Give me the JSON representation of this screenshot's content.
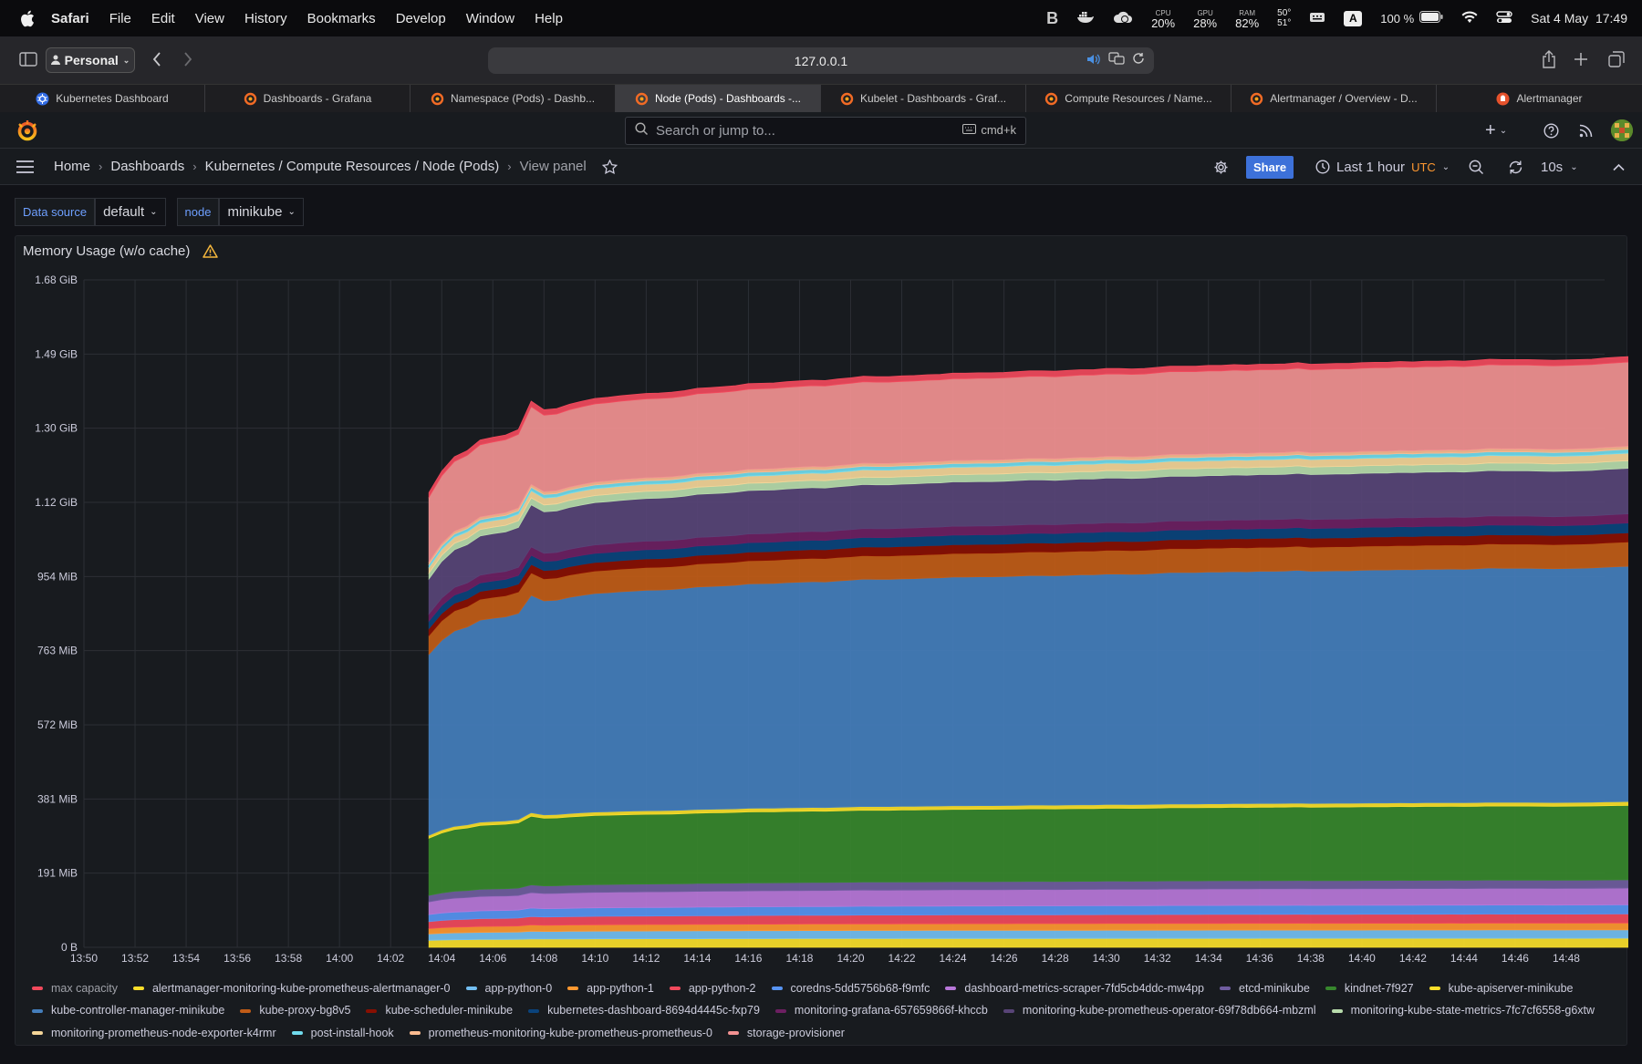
{
  "menubar": {
    "items": [
      "Safari",
      "File",
      "Edit",
      "View",
      "History",
      "Bookmarks",
      "Develop",
      "Window",
      "Help"
    ],
    "stats": [
      {
        "k": "CPU",
        "v": "20%"
      },
      {
        "k": "GPU",
        "v": "28%"
      },
      {
        "k": "RAM",
        "v": "82%"
      }
    ],
    "temp_top": "50°",
    "temp_bottom": "51°",
    "input_source": "A",
    "battery": "100 %",
    "datetime": "Sat 4 May  17:49"
  },
  "browser": {
    "profile": "Personal",
    "url": "127.0.0.1",
    "tabs": [
      {
        "label": "Kubernetes Dashboard",
        "icon": "kubernetes-icon",
        "active": false
      },
      {
        "label": "Dashboards - Grafana",
        "icon": "grafana-icon",
        "active": false
      },
      {
        "label": "Namespace (Pods) - Dashb...",
        "icon": "grafana-icon",
        "active": false
      },
      {
        "label": "Node (Pods) - Dashboards -...",
        "icon": "grafana-icon",
        "active": true
      },
      {
        "label": "Kubelet - Dashboards - Graf...",
        "icon": "grafana-icon",
        "active": false
      },
      {
        "label": "Compute Resources / Name...",
        "icon": "grafana-icon",
        "active": false
      },
      {
        "label": "Alertmanager / Overview - D...",
        "icon": "grafana-icon",
        "active": false
      },
      {
        "label": "Alertmanager",
        "icon": "alertmanager-icon",
        "active": false
      }
    ]
  },
  "grafana": {
    "search_placeholder": "Search or jump to...",
    "search_shortcut": "cmd+k",
    "breadcrumbs": [
      "Home",
      "Dashboards",
      "Kubernetes / Compute Resources / Node (Pods)",
      "View panel"
    ],
    "share_label": "Share",
    "time_range": "Last 1 hour",
    "timezone": "UTC",
    "refresh": "10s",
    "vars": [
      {
        "label": "Data source",
        "value": "default"
      },
      {
        "label": "node",
        "value": "minikube"
      }
    ],
    "panel_title": "Memory Usage (w/o cache)"
  },
  "chart_data": {
    "type": "area",
    "stacked": true,
    "title": "Memory Usage (w/o cache)",
    "y_ticks": [
      "0 B",
      "191 MiB",
      "381 MiB",
      "572 MiB",
      "763 MiB",
      "954 MiB",
      "1.12 GiB",
      "1.30 GiB",
      "1.49 GiB",
      "1.68 GiB"
    ],
    "ylim_mib": [
      0,
      1717
    ],
    "x_ticks": [
      "13:50",
      "13:52",
      "13:54",
      "13:56",
      "13:58",
      "14:00",
      "14:02",
      "14:04",
      "14:06",
      "14:08",
      "14:10",
      "14:12",
      "14:14",
      "14:16",
      "14:18",
      "14:20",
      "14:22",
      "14:24",
      "14:26",
      "14:28",
      "14:30",
      "14:32",
      "14:34",
      "14:36",
      "14:38",
      "14:40",
      "14:42",
      "14:44",
      "14:46",
      "14:48"
    ],
    "x_range_min": [
      0,
      59.5
    ],
    "data_start_min": 13.5,
    "sample_step_min": 0.5,
    "grid": true,
    "legend_position": "bottom",
    "total_mib": [
      1170,
      1225,
      1262,
      1278,
      1305,
      1312,
      1318,
      1332,
      1405,
      1383,
      1386,
      1397,
      1405,
      1412,
      1415,
      1419,
      1422,
      1425,
      1426,
      1428,
      1432,
      1438,
      1440,
      1442,
      1445,
      1450,
      1451,
      1452,
      1455,
      1457,
      1459,
      1458,
      1462,
      1465,
      1469,
      1468,
      1468,
      1470,
      1471,
      1473,
      1474,
      1477,
      1477,
      1478,
      1478,
      1479,
      1481,
      1483,
      1483,
      1482,
      1484,
      1486,
      1486,
      1489,
      1489,
      1488,
      1489,
      1492,
      1495,
      1495,
      1495,
      1497,
      1497,
      1499,
      1498,
      1500,
      1500,
      1501,
      1504,
      1500,
      1501,
      1502,
      1502,
      1504,
      1505,
      1505,
      1507,
      1506,
      1508,
      1508,
      1509,
      1508,
      1510,
      1513,
      1512,
      1512,
      1512,
      1511,
      1510,
      1511,
      1512,
      1513,
      1516,
      1518,
      1520,
      1518,
      1521,
      1522,
      1520,
      1521,
      1520,
      1521,
      1521,
      1523,
      1525,
      1525,
      1525,
      1524,
      1524,
      1525,
      1526,
      1527,
      1528,
      1528,
      1530,
      1530,
      1530,
      1530,
      1531,
      1531,
      1532,
      1534,
      1534,
      1533,
      1533,
      1534,
      1533,
      1534,
      1535,
      1535,
      1536,
      1535,
      1536,
      1537,
      1538,
      1538,
      1539,
      1540,
      1540,
      1541,
      1542,
      1542,
      1543,
      1543,
      1544,
      1544,
      1545,
      1545,
      1546,
      1546,
      1547,
      1547,
      1548,
      1549,
      1550,
      1550,
      1551,
      1551,
      1551,
      1553
    ],
    "series": [
      {
        "name": "max capacity",
        "color": "#f2495c",
        "values_mib": [
          12,
          12,
          12,
          12,
          12,
          12,
          12,
          12,
          14,
          14,
          14,
          14,
          14,
          14,
          14,
          14,
          14,
          14,
          14,
          14,
          14,
          14,
          14,
          14,
          14,
          14,
          14,
          14,
          14,
          14,
          14,
          14,
          14,
          14,
          14,
          14,
          14,
          14,
          14,
          14,
          14,
          14,
          14,
          14,
          14,
          14,
          14,
          14,
          14,
          14,
          14,
          14,
          14,
          14,
          14,
          14,
          14,
          14,
          14,
          14,
          14,
          14,
          14,
          14,
          14,
          14,
          14,
          14,
          14,
          14,
          14,
          14,
          14,
          14,
          14,
          14,
          14,
          14,
          14,
          14,
          14,
          14,
          14,
          14,
          14,
          14,
          14,
          14,
          14,
          14,
          14,
          14,
          14,
          14,
          14,
          14,
          14,
          14,
          14,
          14,
          14,
          14,
          14,
          14,
          14,
          14,
          14,
          14,
          14,
          14,
          14,
          14,
          14,
          14,
          14,
          14,
          14,
          14,
          14,
          14,
          14,
          14,
          14,
          14,
          14,
          14,
          14,
          14,
          14,
          14,
          14,
          14,
          14,
          14,
          14,
          14,
          14,
          14,
          14,
          14,
          14,
          14,
          14,
          14,
          14,
          14,
          14,
          14,
          14,
          14,
          14,
          14,
          14,
          14,
          14,
          14,
          14,
          14,
          14,
          14
        ]
      },
      {
        "name": "alertmanager-monitoring-kube-prometheus-alertmanager-0",
        "color": "#fade2a"
      },
      {
        "name": "app-python-0",
        "color": "#73bff2"
      },
      {
        "name": "app-python-1",
        "color": "#ff9830"
      },
      {
        "name": "app-python-2",
        "color": "#f2495c"
      },
      {
        "name": "coredns-5dd5756b68-f9mfc",
        "color": "#5794f2"
      },
      {
        "name": "dashboard-metrics-scraper-7fd5cb4ddc-mw4pp",
        "color": "#b877d9"
      },
      {
        "name": "etcd-minikube",
        "color": "#705da0"
      },
      {
        "name": "kindnet-7f927",
        "color": "#37872d"
      },
      {
        "name": "kube-apiserver-minikube",
        "color": "#fade2a"
      },
      {
        "name": "kube-controller-manager-minikube",
        "color": "#447ebc"
      },
      {
        "name": "kube-proxy-bg8v5",
        "color": "#c15c17"
      },
      {
        "name": "kube-scheduler-minikube",
        "color": "#890f02"
      },
      {
        "name": "kubernetes-dashboard-8694d4445c-fxp79",
        "color": "#0a437c"
      },
      {
        "name": "monitoring-grafana-657659866f-khccb",
        "color": "#6d1f62"
      },
      {
        "name": "monitoring-kube-prometheus-operator-69f78db664-mbzml",
        "color": "#584477"
      },
      {
        "name": "monitoring-kube-state-metrics-7fc7cf6558-g6xtw",
        "color": "#b7dbab"
      },
      {
        "name": "monitoring-prometheus-node-exporter-k4rmr",
        "color": "#f4d598"
      },
      {
        "name": "post-install-hook",
        "color": "#70dbed"
      },
      {
        "name": "prometheus-monitoring-kube-prometheus-prometheus-0",
        "color": "#f9ba8f"
      },
      {
        "name": "storage-provisioner",
        "color": "#f29191"
      }
    ]
  }
}
